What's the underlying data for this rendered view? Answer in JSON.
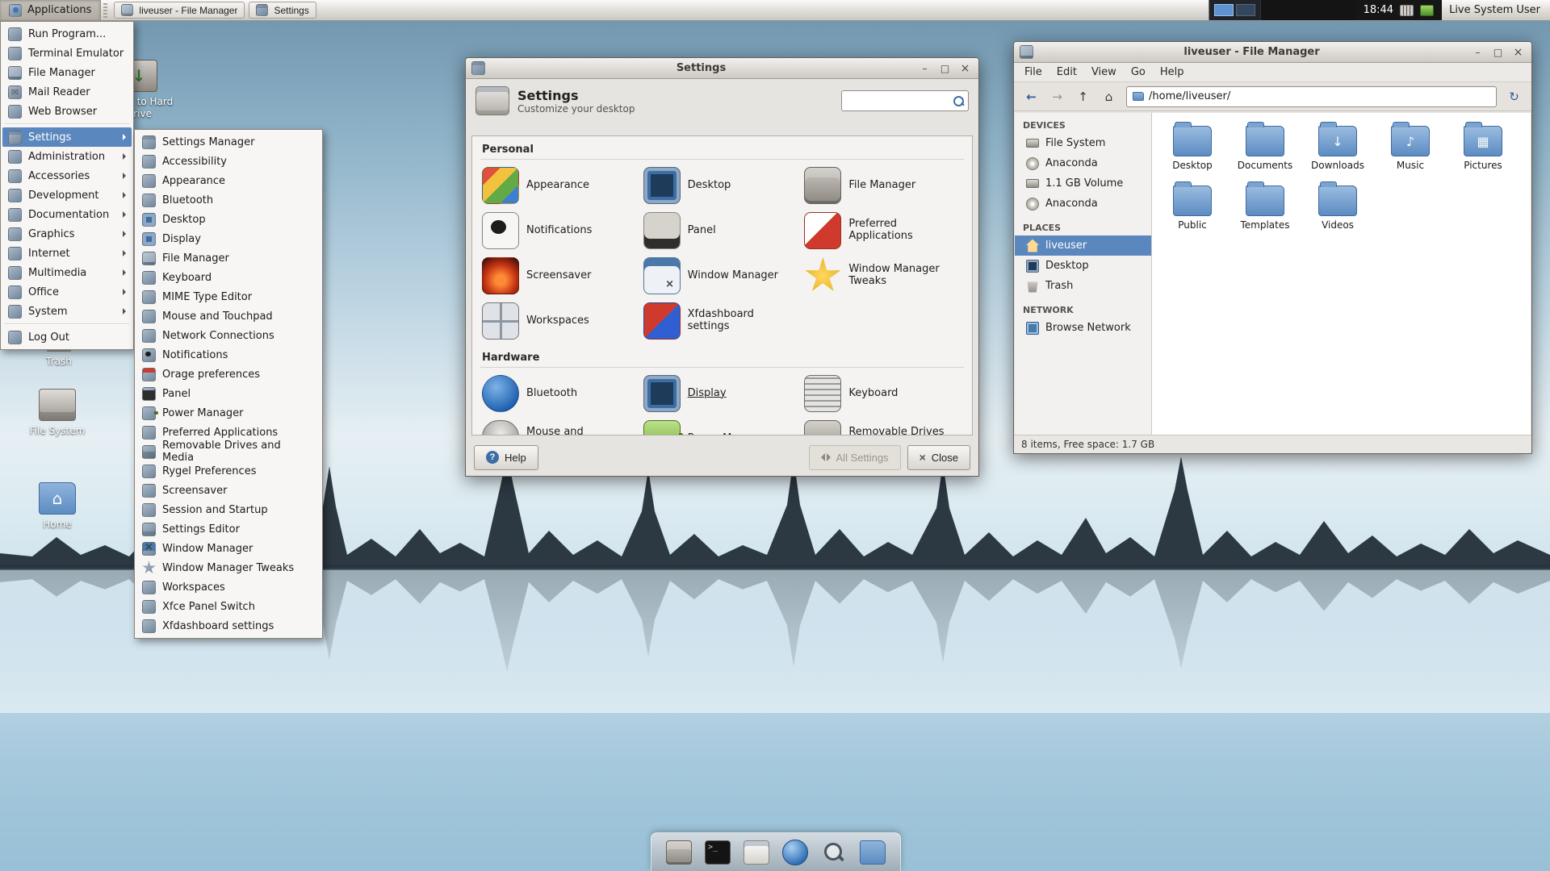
{
  "colors": {
    "selection_blue": "#5a87bd",
    "panel_gray": "#ddd9d4",
    "folder_blue": "#5c8cc2",
    "wallpaper_sky": "#8fb3c8"
  },
  "panel": {
    "applications_label": "Applications",
    "window_buttons": [
      {
        "label": "liveuser - File Manager",
        "icon": "file-manager-icon"
      },
      {
        "label": "Settings",
        "icon": "settings-icon"
      }
    ],
    "clock": "18:44",
    "user_label": "Live System User"
  },
  "app_menu": {
    "top_items": [
      {
        "label": "Run Program...",
        "icon": "run-icon"
      },
      {
        "label": "Terminal Emulator",
        "icon": "terminal-icon"
      },
      {
        "label": "File Manager",
        "icon": "file-manager-icon"
      },
      {
        "label": "Mail Reader",
        "icon": "mail-icon"
      },
      {
        "label": "Web Browser",
        "icon": "web-browser-icon"
      }
    ],
    "categories": [
      {
        "label": "Settings",
        "icon": "settings-icon",
        "state": "selected"
      },
      {
        "label": "Administration",
        "icon": "administration-icon"
      },
      {
        "label": "Accessories",
        "icon": "accessories-icon"
      },
      {
        "label": "Development",
        "icon": "development-icon"
      },
      {
        "label": "Documentation",
        "icon": "documentation-icon"
      },
      {
        "label": "Graphics",
        "icon": "graphics-icon"
      },
      {
        "label": "Internet",
        "icon": "internet-icon"
      },
      {
        "label": "Multimedia",
        "icon": "multimedia-icon"
      },
      {
        "label": "Office",
        "icon": "office-icon"
      },
      {
        "label": "System",
        "icon": "system-icon"
      }
    ],
    "log_out_label": "Log Out",
    "submenu_items": [
      {
        "label": "Settings Manager",
        "icon": "settings-manager-icon"
      },
      {
        "label": "Accessibility",
        "icon": "accessibility-icon"
      },
      {
        "label": "Appearance",
        "icon": "appearance-icon"
      },
      {
        "label": "Bluetooth",
        "icon": "bluetooth-icon"
      },
      {
        "label": "Desktop",
        "icon": "desktop-icon"
      },
      {
        "label": "Display",
        "icon": "display-icon"
      },
      {
        "label": "File Manager",
        "icon": "file-manager-icon"
      },
      {
        "label": "Keyboard",
        "icon": "keyboard-icon"
      },
      {
        "label": "MIME Type Editor",
        "icon": "mime-icon"
      },
      {
        "label": "Mouse and Touchpad",
        "icon": "mouse-icon"
      },
      {
        "label": "Network Connections",
        "icon": "network-icon"
      },
      {
        "label": "Notifications",
        "icon": "notifications-icon"
      },
      {
        "label": "Orage preferences",
        "icon": "orage-icon"
      },
      {
        "label": "Panel",
        "icon": "panel-icon"
      },
      {
        "label": "Power Manager",
        "icon": "power-icon"
      },
      {
        "label": "Preferred Applications",
        "icon": "preferred-apps-icon"
      },
      {
        "label": "Removable Drives and Media",
        "icon": "removable-icon"
      },
      {
        "label": "Rygel Preferences",
        "icon": "rygel-icon"
      },
      {
        "label": "Screensaver",
        "icon": "screensaver-icon"
      },
      {
        "label": "Session and Startup",
        "icon": "session-icon"
      },
      {
        "label": "Settings Editor",
        "icon": "settings-editor-icon"
      },
      {
        "label": "Window Manager",
        "icon": "window-manager-icon"
      },
      {
        "label": "Window Manager Tweaks",
        "icon": "wm-tweaks-icon"
      },
      {
        "label": "Workspaces",
        "icon": "workspaces-icon"
      },
      {
        "label": "Xfce Panel Switch",
        "icon": "panel-switch-icon"
      },
      {
        "label": "Xfdashboard settings",
        "icon": "xfdashboard-icon"
      }
    ]
  },
  "settings_window": {
    "title": "Settings",
    "header": {
      "title": "Settings",
      "subtitle": "Customize your desktop"
    },
    "search_value": "",
    "personal_label": "Personal",
    "personal_items": [
      {
        "label": "Appearance",
        "icon": "appearance-icon"
      },
      {
        "label": "Desktop",
        "icon": "desktop-icon"
      },
      {
        "label": "File Manager",
        "icon": "file-manager-icon"
      },
      {
        "label": "Notifications",
        "icon": "notifications-icon"
      },
      {
        "label": "Panel",
        "icon": "panel-icon"
      },
      {
        "label": "Preferred Applications",
        "icon": "preferred-apps-icon"
      },
      {
        "label": "Screensaver",
        "icon": "screensaver-icon"
      },
      {
        "label": "Window Manager",
        "icon": "window-manager-icon"
      },
      {
        "label": "Window Manager Tweaks",
        "icon": "wm-tweaks-icon"
      },
      {
        "label": "Workspaces",
        "icon": "workspaces-icon"
      },
      {
        "label": "Xfdashboard settings",
        "icon": "xfdashboard-icon"
      }
    ],
    "hardware_label": "Hardware",
    "hardware_items": [
      {
        "label": "Bluetooth",
        "icon": "bluetooth-icon"
      },
      {
        "label": "Display",
        "icon": "display-icon",
        "state": "focused"
      },
      {
        "label": "Keyboard",
        "icon": "keyboard-icon"
      },
      {
        "label": "Mouse and Touchpad",
        "icon": "mouse-icon"
      },
      {
        "label": "Power Manager",
        "icon": "power-icon"
      },
      {
        "label": "Removable Drives and Media",
        "icon": "removable-icon"
      }
    ],
    "help_label": "Help",
    "all_settings_label": "All Settings",
    "close_label": "Close"
  },
  "file_manager": {
    "title": "liveuser - File Manager",
    "menu_items": [
      {
        "label": "File"
      },
      {
        "label": "Edit"
      },
      {
        "label": "View"
      },
      {
        "label": "Go"
      },
      {
        "label": "Help"
      }
    ],
    "path_value": "/home/liveuser/",
    "devices_label": "DEVICES",
    "devices": [
      {
        "label": "File System",
        "icon": "drive-icon"
      },
      {
        "label": "Anaconda",
        "icon": "disc-icon"
      },
      {
        "label": "1.1 GB Volume",
        "icon": "drive-icon"
      },
      {
        "label": "Anaconda",
        "icon": "disc-icon"
      }
    ],
    "places_label": "PLACES",
    "places": [
      {
        "label": "liveuser",
        "icon": "home-icon",
        "state": "selected"
      },
      {
        "label": "Desktop",
        "icon": "desktop-icon"
      },
      {
        "label": "Trash",
        "icon": "trash-icon"
      }
    ],
    "network_label": "NETWORK",
    "network": [
      {
        "label": "Browse Network",
        "icon": "network-icon"
      }
    ],
    "folders": [
      {
        "label": "Desktop",
        "icon": "desktop-folder-icon"
      },
      {
        "label": "Documents",
        "icon": "documents-folder-icon"
      },
      {
        "label": "Downloads",
        "icon": "downloads-folder-icon"
      },
      {
        "label": "Music",
        "icon": "music-folder-icon"
      },
      {
        "label": "Pictures",
        "icon": "pictures-folder-icon"
      },
      {
        "label": "Public",
        "icon": "public-folder-icon"
      },
      {
        "label": "Templates",
        "icon": "templates-folder-icon"
      },
      {
        "label": "Videos",
        "icon": "videos-folder-icon"
      }
    ],
    "status_text": "8 items, Free space: 1.7 GB"
  },
  "desktop_icons": {
    "installer": {
      "label": "Install to Hard Drive",
      "icon": "installer"
    },
    "trash": {
      "label": "Trash",
      "icon": "trash"
    },
    "filesystem": {
      "label": "File System",
      "icon": "drive"
    },
    "home": {
      "label": "Home",
      "icon": "home-folder"
    }
  },
  "dock_items": [
    {
      "name": "file-manager",
      "icon": "file-cabinet"
    },
    {
      "name": "terminal",
      "icon": "terminal"
    },
    {
      "name": "text-editor",
      "icon": "text-editor"
    },
    {
      "name": "web-browser",
      "icon": "web-browser"
    },
    {
      "name": "search",
      "icon": "search"
    },
    {
      "name": "folder",
      "icon": "folder"
    }
  ]
}
